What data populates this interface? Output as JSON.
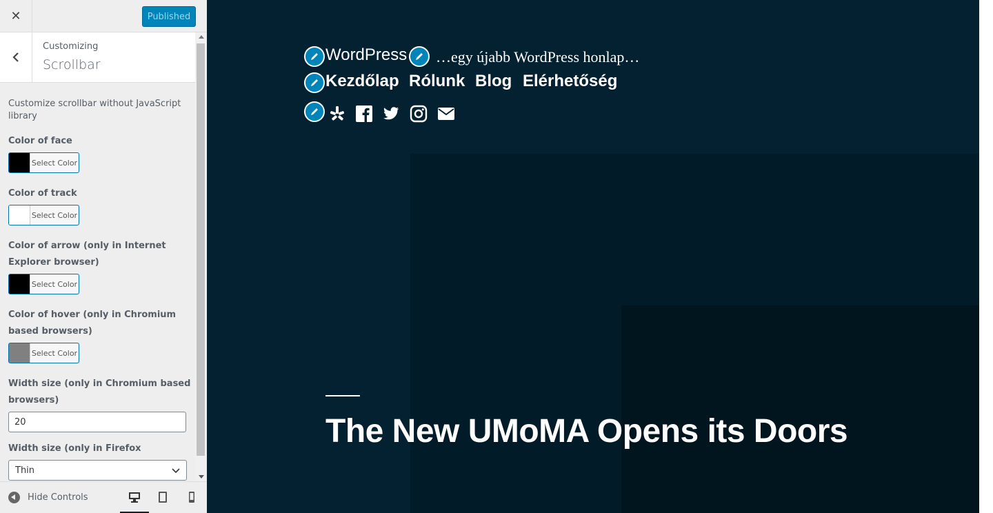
{
  "sidebar": {
    "close_label": "✕",
    "publish_label": "Published",
    "breadcrumb": "Customizing",
    "section_title": "Scrollbar",
    "description": "Customize scrollbar without JavaScript library",
    "controls": [
      {
        "label": "Color of face",
        "button": "Select Color",
        "color": "#000000"
      },
      {
        "label": "Color of track",
        "button": "Select Color",
        "color": "#ffffff"
      },
      {
        "label": "Color of arrow (only in Internet Explorer browser)",
        "button": "Select Color",
        "color": "#000000"
      },
      {
        "label": "Color of hover (only in Chromium based browsers)",
        "button": "Select Color",
        "color": "#808080"
      }
    ],
    "width_chromium": {
      "label": "Width size (only in Chromium based browsers)",
      "value": "20"
    },
    "width_firefox": {
      "label": "Width size (only in Firefox browsers)",
      "value": "Thin"
    },
    "footer": {
      "hide_label": "Hide Controls",
      "devices": [
        "desktop-icon",
        "tablet-icon",
        "mobile-icon"
      ],
      "active_device": "desktop"
    }
  },
  "preview": {
    "site_title": "WordPress",
    "tagline": "…egy újabb WordPress honlap…",
    "menu": [
      "Kezdőlap",
      "Rólunk",
      "Blog",
      "Elérhetőség"
    ],
    "social": [
      "yelp-icon",
      "facebook-icon",
      "twitter-icon",
      "instagram-icon",
      "mail-icon"
    ],
    "hero_title": "The New UMoMA Opens its Doors",
    "background": "#042132",
    "accent": "#0085ba"
  }
}
